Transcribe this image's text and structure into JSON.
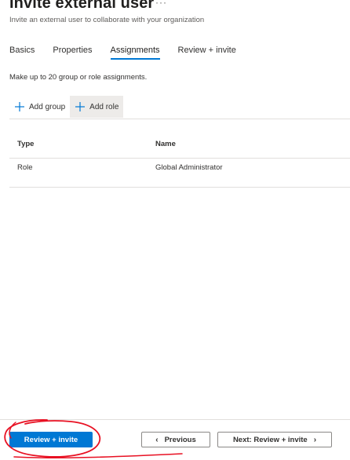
{
  "header": {
    "title": "Invite external user",
    "more_label": "···",
    "subtitle": "Invite an external user to collaborate with your organization"
  },
  "tabs": [
    {
      "label": "Basics",
      "active": false
    },
    {
      "label": "Properties",
      "active": false
    },
    {
      "label": "Assignments",
      "active": true
    },
    {
      "label": "Review + invite",
      "active": false
    }
  ],
  "assignments": {
    "description": "Make up to 20 group or role assignments.",
    "add_group_label": "Add group",
    "add_role_label": "Add role"
  },
  "table": {
    "columns": [
      "Type",
      "Name"
    ],
    "rows": [
      {
        "type": "Role",
        "name": "Global Administrator"
      }
    ]
  },
  "footer": {
    "review_invite_label": "Review + invite",
    "previous_label": "Previous",
    "next_label": "Next: Review + invite"
  },
  "colors": {
    "accent": "#0078d4",
    "annotation": "#e81123"
  }
}
